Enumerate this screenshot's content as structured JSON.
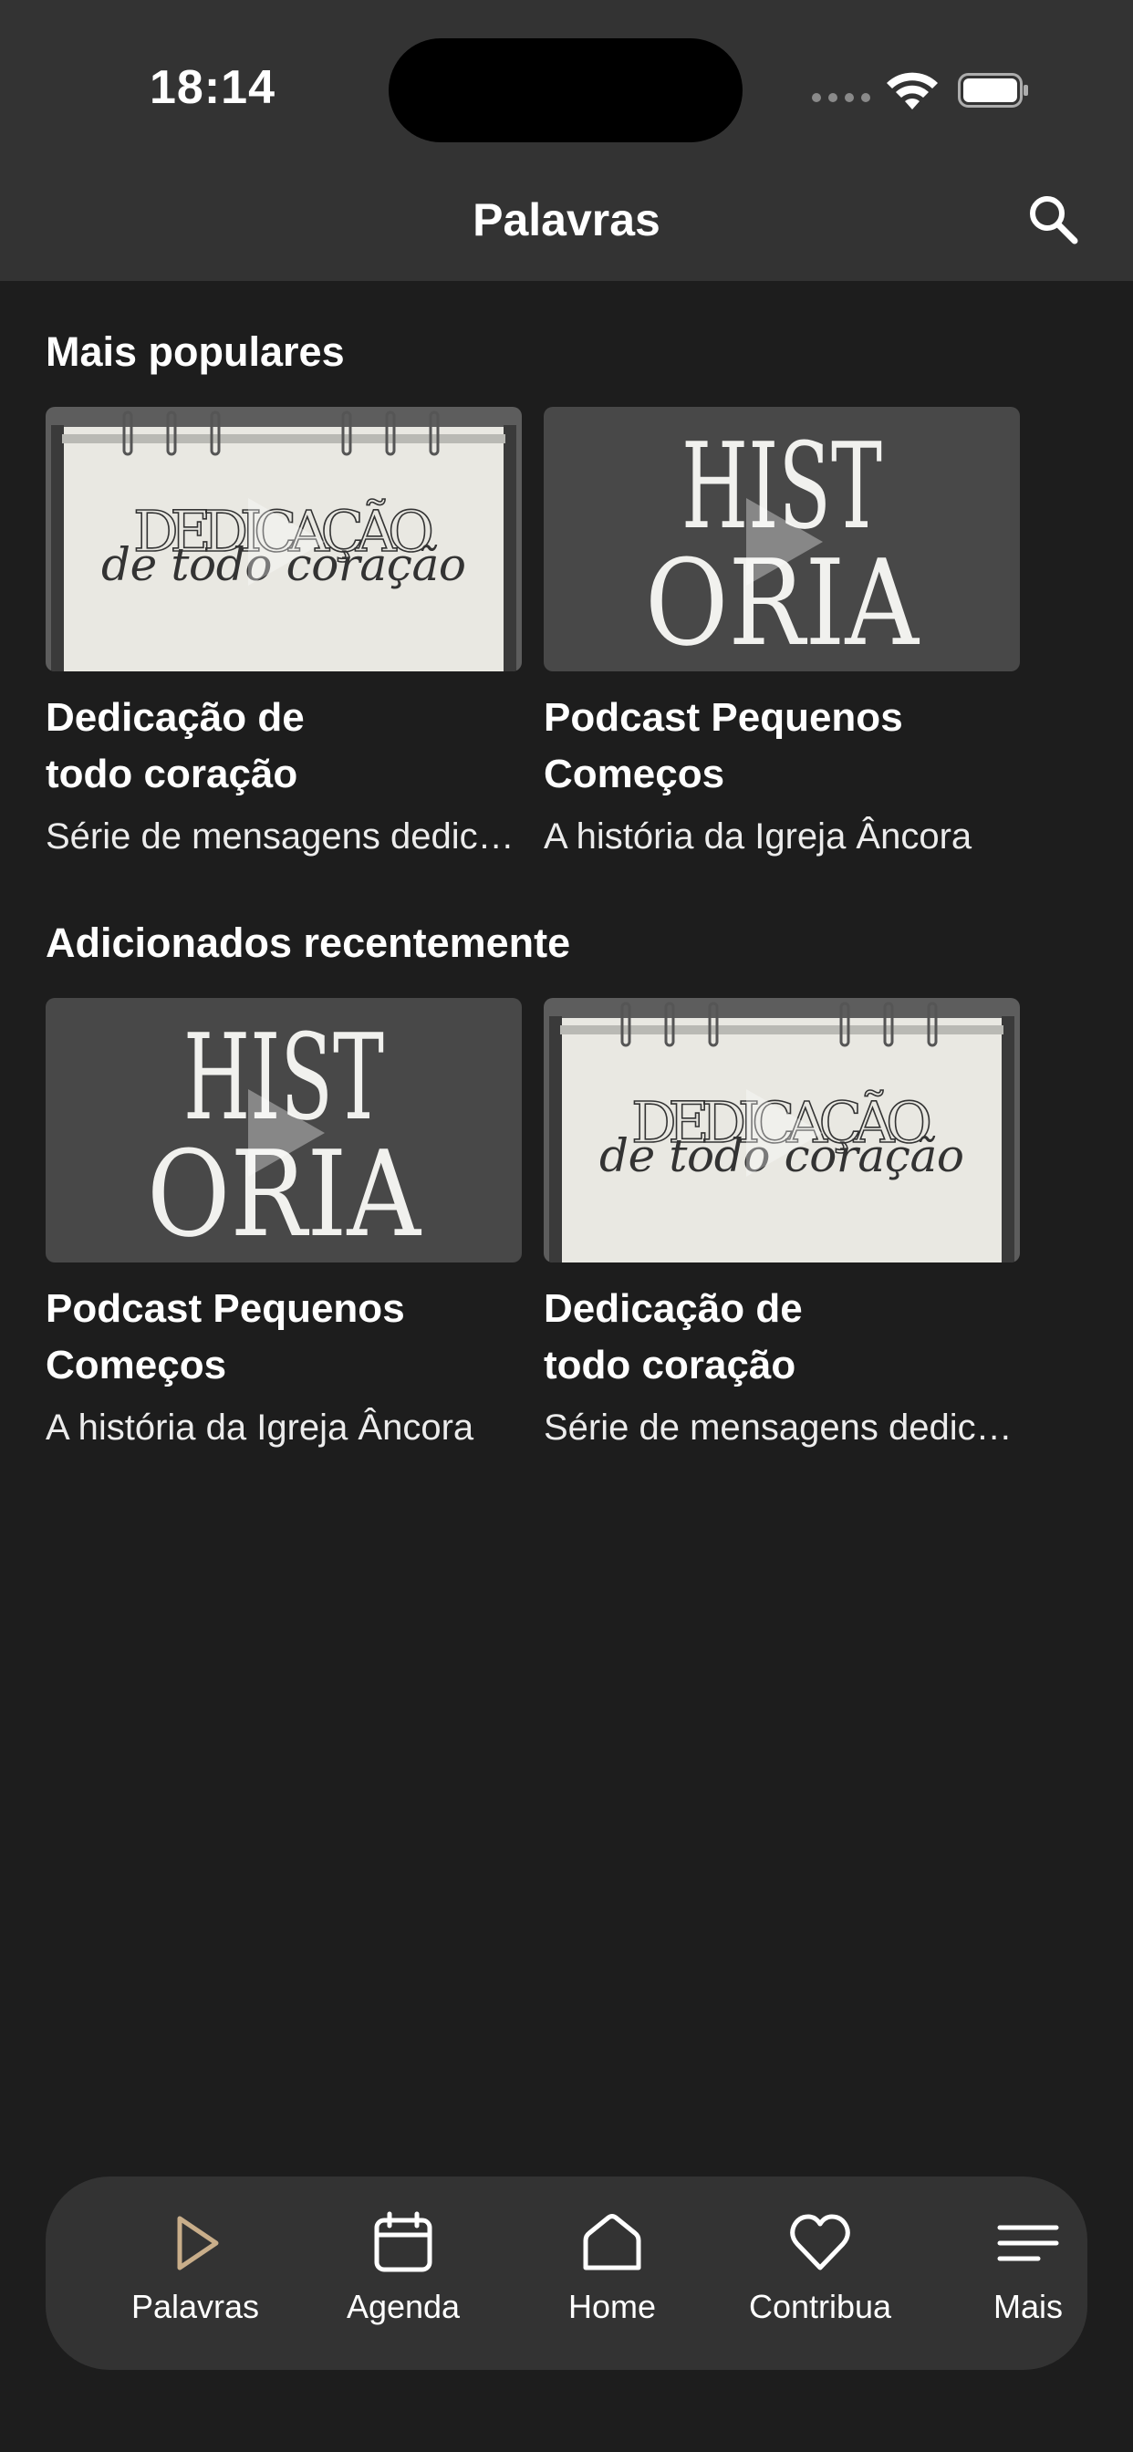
{
  "status_bar": {
    "time": "18:14"
  },
  "header": {
    "title": "Palavras",
    "search_icon": "search-icon"
  },
  "sections": [
    {
      "title": "Mais populares",
      "cards": [
        {
          "title": "Dedicação de\ntodo coração",
          "subtitle": "Série de mensagens dedicação de todo coração",
          "thumb": "dedicacao"
        },
        {
          "title": "Podcast Pequenos\nComeços",
          "subtitle": "A história da Igreja Âncora",
          "thumb": "historia"
        }
      ]
    },
    {
      "title": "Adicionados recentemente",
      "cards": [
        {
          "title": "Podcast Pequenos\nComeços",
          "subtitle": "A história da Igreja Âncora",
          "thumb": "historia"
        },
        {
          "title": "Dedicação de\ntodo coração",
          "subtitle": "Série de mensagens dedicação de todo coração",
          "thumb": "dedicacao"
        }
      ]
    }
  ],
  "thumbs": {
    "dedicacao": {
      "line1": "DEDICAÇÃO",
      "line2": "de todo coração"
    },
    "historia": {
      "line1": "HIST",
      "line2": "ORIA"
    }
  },
  "tabbar": {
    "items": [
      {
        "label": "Palavras",
        "icon": "play-icon",
        "active": true
      },
      {
        "label": "Agenda",
        "icon": "calendar-icon",
        "active": false
      },
      {
        "label": "Home",
        "icon": "home-icon",
        "active": false
      },
      {
        "label": "Contribua",
        "icon": "heart-icon",
        "active": false
      },
      {
        "label": "Mais",
        "icon": "menu-icon",
        "active": false
      }
    ]
  },
  "colors": {
    "accent": "#c9ae8a",
    "background": "#1d1d1d",
    "bar": "#333333"
  }
}
